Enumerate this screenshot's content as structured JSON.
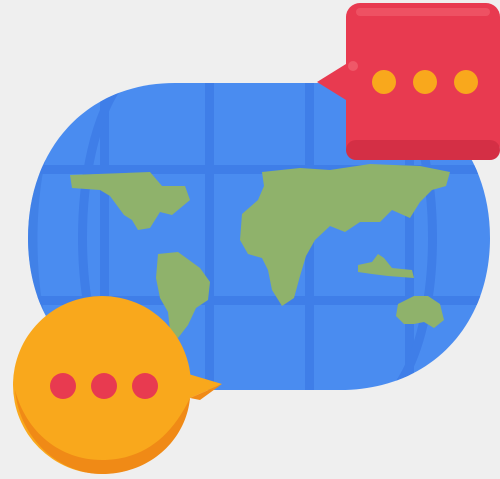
{
  "illustration": {
    "icon": "global-chat-icon",
    "colors": {
      "background": "#efefef",
      "ocean": "#4a8cf0",
      "ocean_shade": "#3a79e0",
      "grid_lines": "#3f7ee8",
      "land": "#8fb26b",
      "land_shade": "#7ea05c",
      "bubble_red": "#e83a50",
      "bubble_red_shade": "#d42f45",
      "bubble_red_dots": "#f9a81c",
      "bubble_orange": "#f9a81c",
      "bubble_orange_shade": "#f08a16",
      "bubble_orange_dots": "#e83a50"
    }
  }
}
